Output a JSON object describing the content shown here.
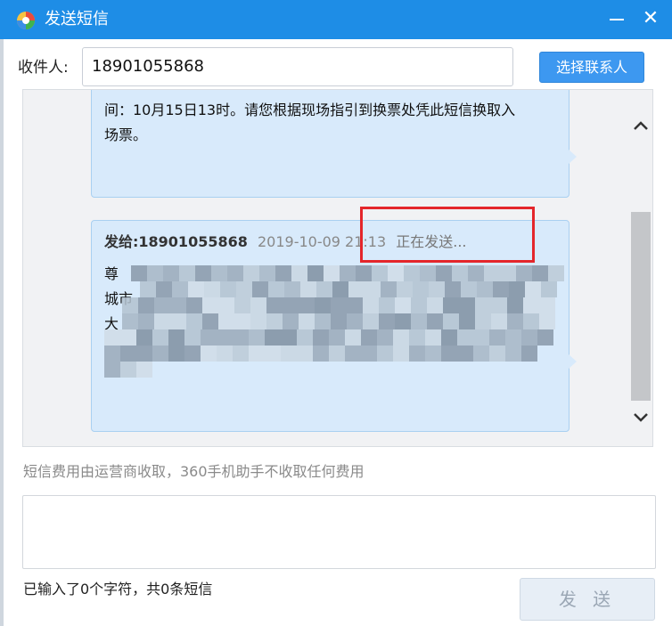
{
  "window": {
    "title": "发送短信",
    "min_icon": "minimize-icon",
    "close_glyph": "✕"
  },
  "recipient": {
    "label": "收件人:",
    "value": "18901055868",
    "contacts_button": "选择联系人"
  },
  "messages": [
    {
      "lines": [
        "间：10月15日13时。请您根据现场指引到换票处凭此短信换取入",
        "场票。"
      ]
    },
    {
      "to": "发给:18901055868",
      "time": "2019-10-09 21:13",
      "status": "正在发送...",
      "visible_lead": [
        "尊",
        "城市",
        "大"
      ]
    }
  ],
  "fee_note": "短信费用由运营商收取，360手机助手不收取任何费用",
  "compose": {
    "value": "",
    "counter": "已输入了0个字符，共0条短信",
    "send_button": "发 送"
  },
  "colors": {
    "titlebar": "#1e8de6",
    "bubble": "#d8eafb",
    "highlight": "#e4262b"
  }
}
